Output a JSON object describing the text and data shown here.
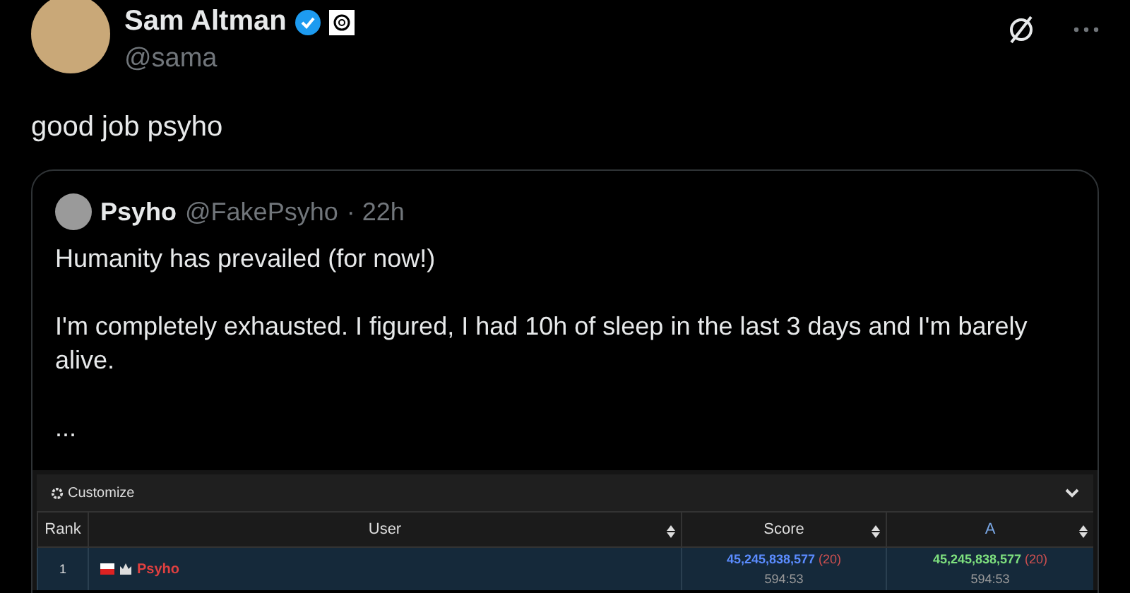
{
  "author": {
    "name": "Sam Altman",
    "verified": true,
    "handle": "@sama"
  },
  "text": "good job psyho",
  "quote": {
    "name": "Psyho",
    "handle": "@FakePsyho",
    "time": "· 22h",
    "paragraphs": [
      "Humanity has prevailed (for now!)",
      "I'm completely exhausted. I figured, I had 10h of sleep in the last 3 days and I'm barely alive.",
      "..."
    ],
    "leaderboard": {
      "customize": "Customize",
      "columns": [
        {
          "label": "Rank",
          "kind": "rank"
        },
        {
          "label": "User",
          "kind": "user"
        },
        {
          "label": "Score",
          "kind": "score"
        },
        {
          "label": "A",
          "kind": "task"
        }
      ],
      "rows": [
        {
          "rank": "1",
          "user": "Psyho",
          "score": "45,245,838,577",
          "score_count": "(20)",
          "score_time": "594:53",
          "a": "45,245,838,577",
          "a_count": "(20)",
          "a_time": "594:53"
        }
      ]
    }
  }
}
